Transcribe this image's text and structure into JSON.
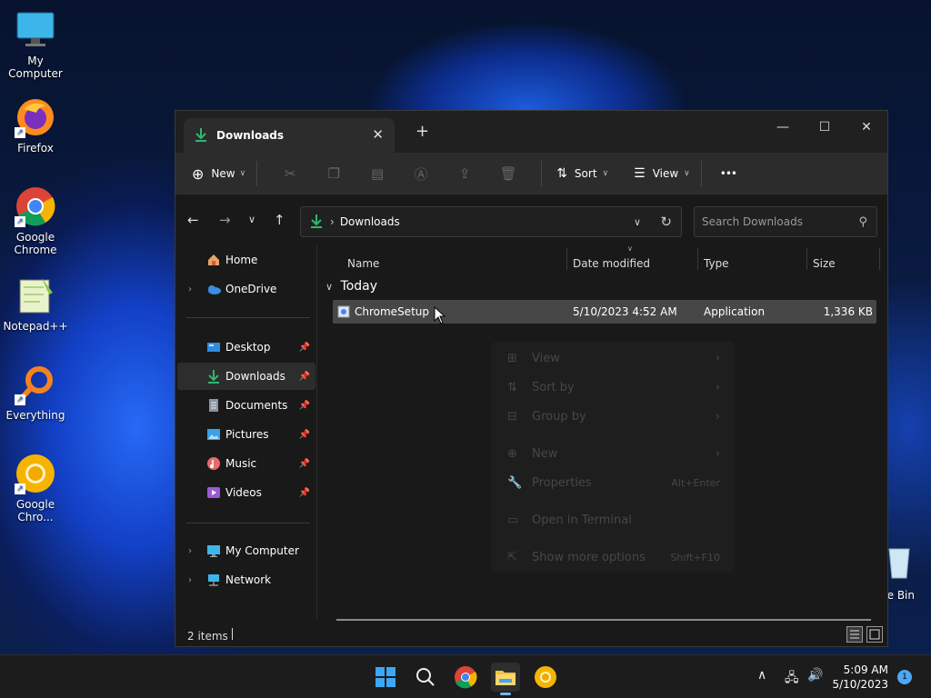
{
  "desktop": {
    "icons": [
      {
        "label": "My Computer",
        "icon": "monitor-icon"
      },
      {
        "label": "Firefox",
        "icon": "firefox-icon"
      },
      {
        "label": "Google Chrome",
        "icon": "chrome-icon"
      },
      {
        "label": "Notepad++",
        "icon": "notepadpp-icon"
      },
      {
        "label": "Everything",
        "icon": "search-magnifier-icon"
      },
      {
        "label": "Google Chro...",
        "icon": "chrome-canary-icon"
      }
    ],
    "recycle_bin_label": "le Bin"
  },
  "window": {
    "tab_title": "Downloads",
    "new_tab_symbol": "+",
    "close_tab_symbol": "✕",
    "controls": {
      "minimize": "—",
      "maximize": "☐",
      "close": "✕"
    }
  },
  "toolbar": {
    "new_label": "New",
    "sort_label": "Sort",
    "view_label": "View",
    "more_label": "•••"
  },
  "address": {
    "path": "Downloads",
    "search_placeholder": "Search Downloads"
  },
  "navpane": {
    "items": [
      {
        "label": "Home",
        "icon": "home-icon",
        "chevron": false,
        "pinned": false
      },
      {
        "label": "OneDrive",
        "icon": "cloud-icon",
        "chevron": true,
        "pinned": false
      },
      {
        "label": "Desktop",
        "icon": "desktop-icon",
        "chevron": false,
        "pinned": true
      },
      {
        "label": "Downloads",
        "icon": "download-icon",
        "chevron": false,
        "pinned": true,
        "selected": true
      },
      {
        "label": "Documents",
        "icon": "document-icon",
        "chevron": false,
        "pinned": true
      },
      {
        "label": "Pictures",
        "icon": "pictures-icon",
        "chevron": false,
        "pinned": true
      },
      {
        "label": "Music",
        "icon": "music-icon",
        "chevron": false,
        "pinned": true
      },
      {
        "label": "Videos",
        "icon": "videos-icon",
        "chevron": false,
        "pinned": true
      },
      {
        "label": "My Computer",
        "icon": "monitor-icon",
        "chevron": true,
        "pinned": false
      },
      {
        "label": "Network",
        "icon": "network-icon",
        "chevron": true,
        "pinned": false
      }
    ]
  },
  "filelist": {
    "columns": {
      "name": "Name",
      "date": "Date modified",
      "type": "Type",
      "size": "Size"
    },
    "group": "Today",
    "rows": [
      {
        "name": "ChromeSetup",
        "date": "5/10/2023 4:52 AM",
        "type": "Application",
        "size": "1,336 KB"
      }
    ]
  },
  "context_menu": {
    "items": [
      {
        "label": "View",
        "icon": "grid-icon",
        "arrow": true,
        "shortcut": ""
      },
      {
        "label": "Sort by",
        "icon": "sort-icon",
        "arrow": true,
        "shortcut": ""
      },
      {
        "label": "Group by",
        "icon": "group-icon",
        "arrow": true,
        "shortcut": ""
      },
      {
        "label": "New",
        "icon": "plus-circle-icon",
        "arrow": true,
        "shortcut": ""
      },
      {
        "label": "Properties",
        "icon": "wrench-icon",
        "arrow": false,
        "shortcut": "Alt+Enter"
      },
      {
        "label": "Open in Terminal",
        "icon": "terminal-icon",
        "arrow": false,
        "shortcut": ""
      },
      {
        "label": "Show more options",
        "icon": "share-icon",
        "arrow": false,
        "shortcut": "Shift+F10"
      }
    ]
  },
  "statusbar": {
    "count": "2 items"
  },
  "taskbar": {
    "time": "5:09 AM",
    "date": "5/10/2023",
    "notification_count": "1",
    "chevron": "∧"
  },
  "colors": {
    "accent_green": "#2fb86e",
    "selection": "#474747",
    "window_bg": "#191919",
    "toolbar_bg": "#2c2c2c"
  }
}
